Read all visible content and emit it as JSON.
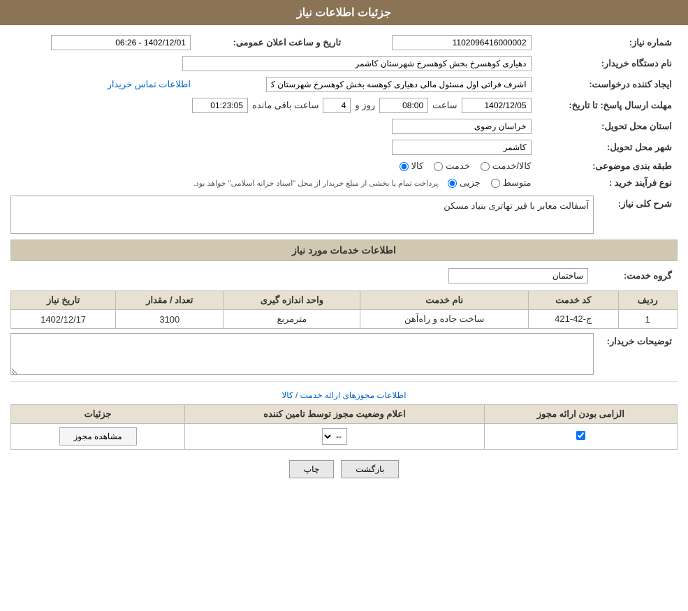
{
  "page": {
    "title": "جزئیات اطلاعات نیاز",
    "header": {
      "bg_color": "#8B7355"
    }
  },
  "fields": {
    "need_number_label": "شماره نیاز:",
    "need_number_value": "1102096416000002",
    "buyer_org_label": "نام دستگاه خریدار:",
    "buyer_org_value": "دهیاری کوهسرخ بخش کوهسرخ شهرستان کاشمر",
    "requester_label": "ایجاد کننده درخواست:",
    "requester_value": "اشرف فراتی اول مسئول مالی دهیاری کوهسه بخش کوهسرخ شهرستان کاشمر",
    "contact_link": "اطلاعات تماس خریدار",
    "deadline_label": "مهلت ارسال پاسخ: تا تاریخ:",
    "deadline_date": "1402/12/05",
    "deadline_time_label": "ساعت",
    "deadline_time": "08:00",
    "deadline_day_label": "روز و",
    "deadline_days": "4",
    "deadline_remaining_label": "ساعت باقی مانده",
    "deadline_remaining": "01:23:05",
    "announce_label": "تاریخ و ساعت اعلان عمومی:",
    "announce_value": "1402/12/01 - 06:26",
    "province_label": "استان محل تحویل:",
    "province_value": "خراسان رضوی",
    "city_label": "شهر محل تحویل:",
    "city_value": "کاشمر",
    "category_label": "طبقه بندی موضوعی:",
    "category_kala": "کالا",
    "category_khadamat": "خدمت",
    "category_kala_khadamat": "کالا/خدمت",
    "purchase_type_label": "نوع فرآیند خرید :",
    "purchase_jozei": "جزیی",
    "purchase_motawaset": "متوسط",
    "purchase_note": "پرداخت تمام یا بخشی از مبلغ خریدار از محل \"اسناد خزانه اسلامی\" خواهد بود.",
    "need_desc_label": "شرح کلی نیاز:",
    "need_desc_value": "آسفالت معابر با قیر تهاتری بنیاد مسکن",
    "services_title": "اطلاعات خدمات مورد نیاز",
    "service_group_label": "گروه خدمت:",
    "service_group_value": "ساختمان",
    "table": {
      "col_radif": "ردیف",
      "col_code": "کد خدمت",
      "col_name": "نام خدمت",
      "col_unit": "واحد اندازه گیری",
      "col_count": "تعداد / مقدار",
      "col_date": "تاریخ نیاز",
      "rows": [
        {
          "radif": "1",
          "code": "ج-42-421",
          "name": "ساخت جاده و راه‌آهن",
          "unit": "مترمربع",
          "count": "3100",
          "date": "1402/12/17"
        }
      ]
    },
    "buyer_notes_label": "توضیحات خریدار:",
    "buyer_notes_value": "",
    "permissions_link_text": "اطلاعات مجوزهای ارائه خدمت / کالا",
    "perm_table": {
      "col_required": "الزامی بودن ارائه مجوز",
      "col_status": "اعلام وضعیت مجوز توسط تامین کننده",
      "col_details": "جزئیات",
      "rows": [
        {
          "required_checked": true,
          "status": "--",
          "details_btn": "مشاهده مجوز"
        }
      ]
    },
    "btn_print": "چاپ",
    "btn_back": "بازگشت"
  }
}
